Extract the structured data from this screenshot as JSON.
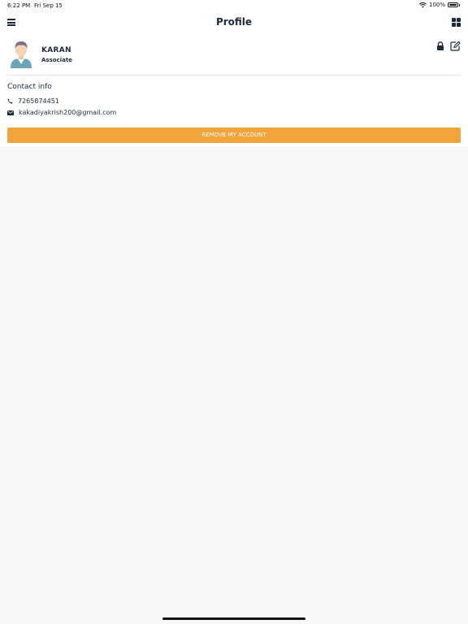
{
  "status_bar": {
    "time": "6:22 PM",
    "date": "Fri Sep 15",
    "battery": "100%"
  },
  "nav": {
    "title": "Profile",
    "left_icon": "hamburger-menu-icon",
    "right_icon": "grid-icon"
  },
  "profile": {
    "name": "KARAN",
    "role": "Associate",
    "actions": [
      "lock-icon",
      "edit-icon"
    ]
  },
  "contact": {
    "section_title": "Contact info",
    "phone": "7265874451",
    "email": "kakadiyakrish200@gmail.com"
  },
  "remove_button_label": "REMOVE MY ACCOUNT",
  "colors": {
    "accent": "#f1a43b",
    "text_primary": "#1e2a3a",
    "background": "#f7f7f7"
  }
}
